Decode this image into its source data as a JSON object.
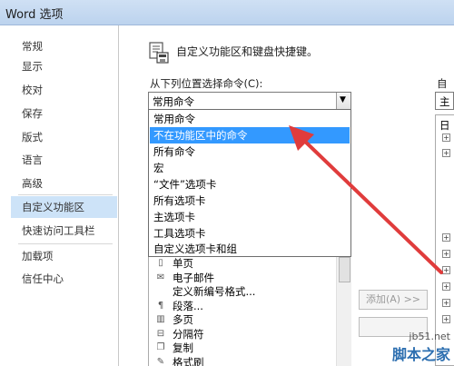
{
  "window": {
    "title": "Word 选项"
  },
  "nav": {
    "items": [
      {
        "label": "常规"
      },
      {
        "label": "显示"
      },
      {
        "label": "校对"
      },
      {
        "label": "保存"
      },
      {
        "label": "版式"
      },
      {
        "label": "语言"
      },
      {
        "label": "高级"
      },
      {
        "label": "自定义功能区",
        "active": true
      },
      {
        "label": "快速访问工具栏"
      },
      {
        "label": "加载项"
      },
      {
        "label": "信任中心"
      }
    ]
  },
  "header": {
    "text": "自定义功能区和键盘快捷键。"
  },
  "commands": {
    "label": "从下列位置选择命令(C):",
    "selected": "常用命令",
    "dropdown_options": [
      "常用命令",
      "不在功能区中的命令",
      "所有命令",
      "宏",
      "“文件”选项卡",
      "所有选项卡",
      "主选项卡",
      "工具选项卡",
      "自定义选项卡和组"
    ],
    "highlighted_option": "不在功能区中的命令",
    "list_items": [
      {
        "label": "单页",
        "icon": "page-icon"
      },
      {
        "label": "电子邮件",
        "icon": "email-icon"
      },
      {
        "label": "定义新编号格式...",
        "icon": "numbering-icon"
      },
      {
        "label": "段落...",
        "icon": "paragraph-icon"
      },
      {
        "label": "多页",
        "icon": "multipage-icon"
      },
      {
        "label": "分隔符",
        "icon": "separator-icon"
      },
      {
        "label": "复制",
        "icon": "copy-icon"
      },
      {
        "label": "格式刷",
        "icon": "format-painter-icon"
      }
    ]
  },
  "buttons": {
    "add": "添加(A) >>"
  },
  "right_panel": {
    "label": "自定",
    "combo_value": "主",
    "tree_top_glyph": "日"
  },
  "watermark": {
    "url": "jb51.net",
    "brand": "脚本之家"
  },
  "colors": {
    "selection": "#3399ff",
    "nav_active": "#cde3f8",
    "arrow": "#e03c3c"
  }
}
